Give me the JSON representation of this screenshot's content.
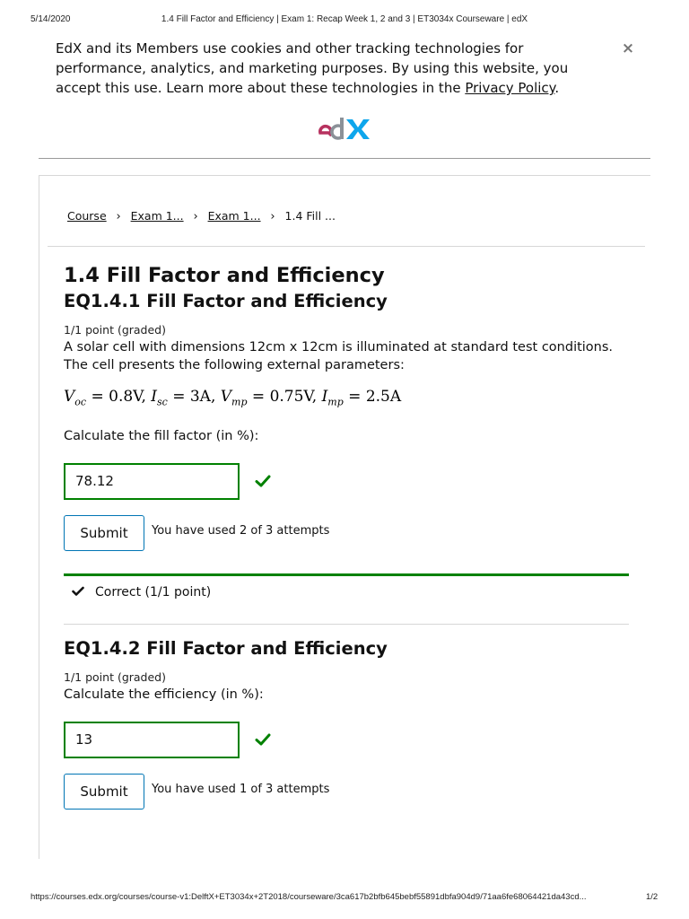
{
  "print_header": {
    "date": "5/14/2020",
    "title": "1.4 Fill Factor and Efficiency | Exam 1: Recap Week 1, 2 and 3 | ET3034x Courseware | edX"
  },
  "cookie_banner": {
    "text": "EdX and its Members use cookies and other tracking technologies for performance, analytics, and marketing purposes. By using this website, you accept this use. Learn more about these technologies in the ",
    "link": "Privacy Policy",
    "after": ".",
    "close": "×"
  },
  "logo": {
    "text": "edX",
    "colors": {
      "e": "#b7325f",
      "d": "#8b9198",
      "x": "#0ea6ec"
    }
  },
  "breadcrumb": {
    "items": [
      "Course",
      "Exam 1...",
      "Exam 1..."
    ],
    "current": "1.4 Fill ...",
    "separator": "›"
  },
  "unit": {
    "title": "1.4 Fill Factor and Efficiency"
  },
  "problems": [
    {
      "title": "EQ1.4.1 Fill Factor and Efficiency",
      "points": "1/1 point (graded)",
      "description": "A solar cell with dimensions 12cm x 12cm is illuminated at standard test conditions. The cell presents the following external parameters:",
      "formula": {
        "voc_sym": "V",
        "voc_sub": "oc",
        "voc_val": " = 0.8V, ",
        "isc_sym": "I",
        "isc_sub": "sc",
        "isc_val": " = 3A, ",
        "vmp_sym": "V",
        "vmp_sub": "mp",
        "vmp_val": " = 0.75V, ",
        "imp_sym": "I",
        "imp_sub": "mp",
        "imp_val": " = 2.5A"
      },
      "question": "Calculate the fill factor (in %):",
      "answer": "78.12",
      "submit_label": "Submit",
      "attempts": "You have used 2 of 3 attempts",
      "status": "Correct (1/1 point)"
    },
    {
      "title": "EQ1.4.2 Fill Factor and Efficiency",
      "points": "1/1 point (graded)",
      "question": "Calculate the efficiency (in %):",
      "answer": "13",
      "submit_label": "Submit",
      "attempts": "You have used 1 of 3 attempts"
    }
  ],
  "colors": {
    "correct": "#008100",
    "button_border": "#0075b4"
  },
  "print_footer": {
    "url": "https://courses.edx.org/courses/course-v1:DelftX+ET3034x+2T2018/courseware/3ca617b2bfb645bebf55891dbfa904d9/71aa6fe68064421da43cd...",
    "page": "1/2"
  }
}
